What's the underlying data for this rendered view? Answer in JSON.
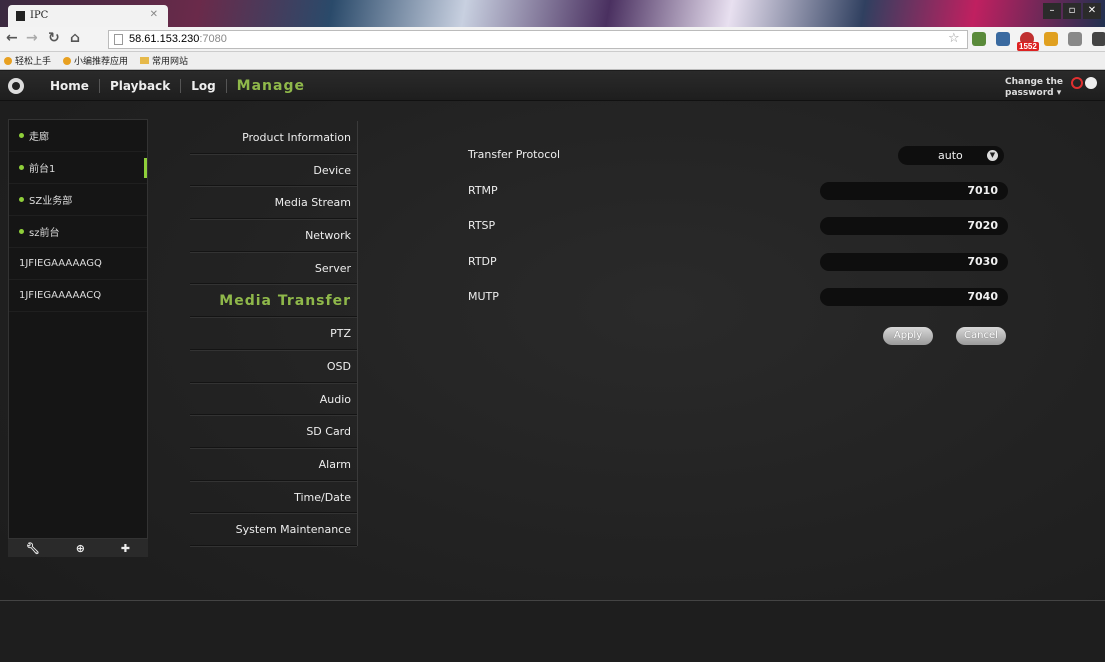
{
  "browser": {
    "tab_title": "IPC",
    "url_host": "58.61.153.230",
    "url_port": ":7080",
    "bookmarks": [
      "轻松上手",
      "小编推荐应用",
      "常用网站"
    ],
    "badge_count": "1552"
  },
  "nav": {
    "items": [
      "Home",
      "Playback",
      "Log",
      "Manage"
    ],
    "active": "Manage",
    "change_password_line1": "Change the",
    "change_password_line2": "password ▾"
  },
  "devices": [
    {
      "name": "走廊",
      "online": true
    },
    {
      "name": "前台1",
      "online": true,
      "selected": true
    },
    {
      "name": "SZ业务部",
      "online": true
    },
    {
      "name": "sz前台",
      "online": true
    },
    {
      "name": "1JFIEGAAAAAGQ",
      "online": false
    },
    {
      "name": "1JFIEGAAAAACQ",
      "online": false
    }
  ],
  "menu": {
    "items": [
      "Product Information",
      "Device",
      "Media Stream",
      "Network",
      "Server",
      "Media Transfer",
      "PTZ",
      "OSD",
      "Audio",
      "SD Card",
      "Alarm",
      "Time/Date",
      "System Maintenance"
    ],
    "active_index": 5
  },
  "form": {
    "transfer_protocol_label": "Transfer Protocol",
    "transfer_protocol_value": "auto",
    "ports": [
      {
        "label": "RTMP",
        "value": "7010"
      },
      {
        "label": "RTSP",
        "value": "7020"
      },
      {
        "label": "RTDP",
        "value": "7030"
      },
      {
        "label": "MUTP",
        "value": "7040"
      }
    ],
    "apply_label": "Apply",
    "cancel_label": "Cancel"
  },
  "colors": {
    "accent": "#8fb84a",
    "online_dot": "#8fcf3a"
  }
}
